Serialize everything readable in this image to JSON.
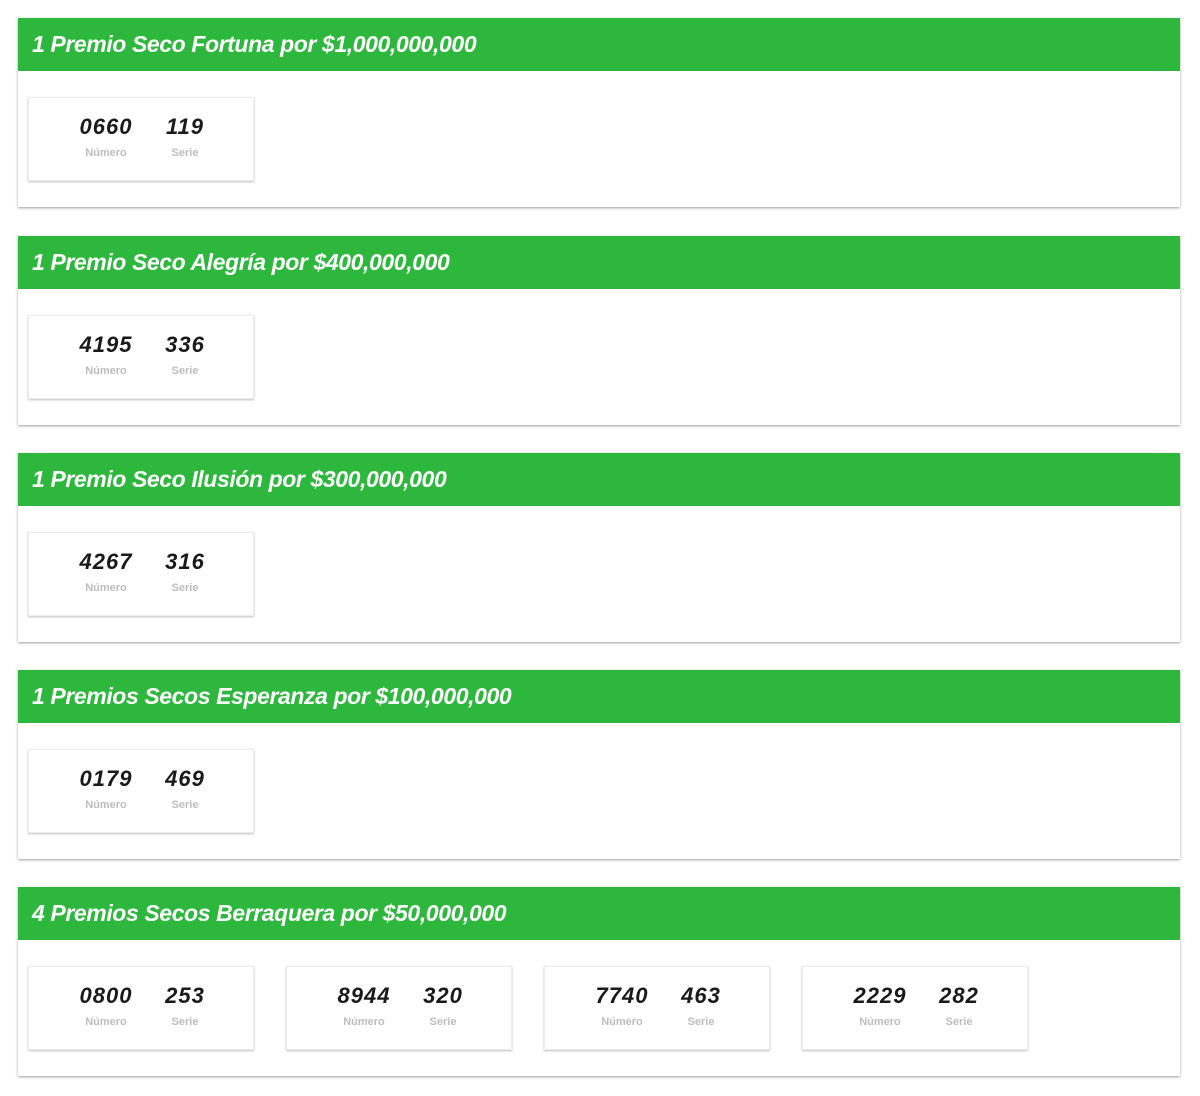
{
  "colors": {
    "header_bg": "#2db83d",
    "header_text": "#ffffff",
    "ticket_value": "#1a1a1a",
    "ticket_label": "#bdbdbd"
  },
  "labels": {
    "numero": "Número",
    "serie": "Serie"
  },
  "prizes": [
    {
      "title": "1 Premio Seco Fortuna por $1,000,000,000",
      "tickets": [
        {
          "numero": "0660",
          "serie": "119"
        }
      ]
    },
    {
      "title": "1 Premio Seco Alegría por $400,000,000",
      "tickets": [
        {
          "numero": "4195",
          "serie": "336"
        }
      ]
    },
    {
      "title": "1 Premio Seco Ilusión por $300,000,000",
      "tickets": [
        {
          "numero": "4267",
          "serie": "316"
        }
      ]
    },
    {
      "title": "1 Premios Secos Esperanza por $100,000,000",
      "tickets": [
        {
          "numero": "0179",
          "serie": "469"
        }
      ]
    },
    {
      "title": "4 Premios Secos Berraquera por $50,000,000",
      "tickets": [
        {
          "numero": "0800",
          "serie": "253"
        },
        {
          "numero": "8944",
          "serie": "320"
        },
        {
          "numero": "7740",
          "serie": "463"
        },
        {
          "numero": "2229",
          "serie": "282"
        }
      ]
    }
  ]
}
